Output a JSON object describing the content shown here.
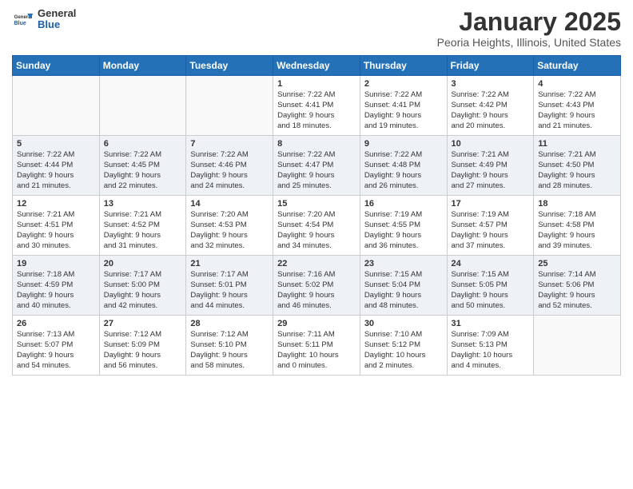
{
  "header": {
    "logo_general": "General",
    "logo_blue": "Blue",
    "month": "January 2025",
    "location": "Peoria Heights, Illinois, United States"
  },
  "days_of_week": [
    "Sunday",
    "Monday",
    "Tuesday",
    "Wednesday",
    "Thursday",
    "Friday",
    "Saturday"
  ],
  "weeks": [
    [
      {
        "day": "",
        "info": ""
      },
      {
        "day": "",
        "info": ""
      },
      {
        "day": "",
        "info": ""
      },
      {
        "day": "1",
        "info": "Sunrise: 7:22 AM\nSunset: 4:41 PM\nDaylight: 9 hours\nand 18 minutes."
      },
      {
        "day": "2",
        "info": "Sunrise: 7:22 AM\nSunset: 4:41 PM\nDaylight: 9 hours\nand 19 minutes."
      },
      {
        "day": "3",
        "info": "Sunrise: 7:22 AM\nSunset: 4:42 PM\nDaylight: 9 hours\nand 20 minutes."
      },
      {
        "day": "4",
        "info": "Sunrise: 7:22 AM\nSunset: 4:43 PM\nDaylight: 9 hours\nand 21 minutes."
      }
    ],
    [
      {
        "day": "5",
        "info": "Sunrise: 7:22 AM\nSunset: 4:44 PM\nDaylight: 9 hours\nand 21 minutes."
      },
      {
        "day": "6",
        "info": "Sunrise: 7:22 AM\nSunset: 4:45 PM\nDaylight: 9 hours\nand 22 minutes."
      },
      {
        "day": "7",
        "info": "Sunrise: 7:22 AM\nSunset: 4:46 PM\nDaylight: 9 hours\nand 24 minutes."
      },
      {
        "day": "8",
        "info": "Sunrise: 7:22 AM\nSunset: 4:47 PM\nDaylight: 9 hours\nand 25 minutes."
      },
      {
        "day": "9",
        "info": "Sunrise: 7:22 AM\nSunset: 4:48 PM\nDaylight: 9 hours\nand 26 minutes."
      },
      {
        "day": "10",
        "info": "Sunrise: 7:21 AM\nSunset: 4:49 PM\nDaylight: 9 hours\nand 27 minutes."
      },
      {
        "day": "11",
        "info": "Sunrise: 7:21 AM\nSunset: 4:50 PM\nDaylight: 9 hours\nand 28 minutes."
      }
    ],
    [
      {
        "day": "12",
        "info": "Sunrise: 7:21 AM\nSunset: 4:51 PM\nDaylight: 9 hours\nand 30 minutes."
      },
      {
        "day": "13",
        "info": "Sunrise: 7:21 AM\nSunset: 4:52 PM\nDaylight: 9 hours\nand 31 minutes."
      },
      {
        "day": "14",
        "info": "Sunrise: 7:20 AM\nSunset: 4:53 PM\nDaylight: 9 hours\nand 32 minutes."
      },
      {
        "day": "15",
        "info": "Sunrise: 7:20 AM\nSunset: 4:54 PM\nDaylight: 9 hours\nand 34 minutes."
      },
      {
        "day": "16",
        "info": "Sunrise: 7:19 AM\nSunset: 4:55 PM\nDaylight: 9 hours\nand 36 minutes."
      },
      {
        "day": "17",
        "info": "Sunrise: 7:19 AM\nSunset: 4:57 PM\nDaylight: 9 hours\nand 37 minutes."
      },
      {
        "day": "18",
        "info": "Sunrise: 7:18 AM\nSunset: 4:58 PM\nDaylight: 9 hours\nand 39 minutes."
      }
    ],
    [
      {
        "day": "19",
        "info": "Sunrise: 7:18 AM\nSunset: 4:59 PM\nDaylight: 9 hours\nand 40 minutes."
      },
      {
        "day": "20",
        "info": "Sunrise: 7:17 AM\nSunset: 5:00 PM\nDaylight: 9 hours\nand 42 minutes."
      },
      {
        "day": "21",
        "info": "Sunrise: 7:17 AM\nSunset: 5:01 PM\nDaylight: 9 hours\nand 44 minutes."
      },
      {
        "day": "22",
        "info": "Sunrise: 7:16 AM\nSunset: 5:02 PM\nDaylight: 9 hours\nand 46 minutes."
      },
      {
        "day": "23",
        "info": "Sunrise: 7:15 AM\nSunset: 5:04 PM\nDaylight: 9 hours\nand 48 minutes."
      },
      {
        "day": "24",
        "info": "Sunrise: 7:15 AM\nSunset: 5:05 PM\nDaylight: 9 hours\nand 50 minutes."
      },
      {
        "day": "25",
        "info": "Sunrise: 7:14 AM\nSunset: 5:06 PM\nDaylight: 9 hours\nand 52 minutes."
      }
    ],
    [
      {
        "day": "26",
        "info": "Sunrise: 7:13 AM\nSunset: 5:07 PM\nDaylight: 9 hours\nand 54 minutes."
      },
      {
        "day": "27",
        "info": "Sunrise: 7:12 AM\nSunset: 5:09 PM\nDaylight: 9 hours\nand 56 minutes."
      },
      {
        "day": "28",
        "info": "Sunrise: 7:12 AM\nSunset: 5:10 PM\nDaylight: 9 hours\nand 58 minutes."
      },
      {
        "day": "29",
        "info": "Sunrise: 7:11 AM\nSunset: 5:11 PM\nDaylight: 10 hours\nand 0 minutes."
      },
      {
        "day": "30",
        "info": "Sunrise: 7:10 AM\nSunset: 5:12 PM\nDaylight: 10 hours\nand 2 minutes."
      },
      {
        "day": "31",
        "info": "Sunrise: 7:09 AM\nSunset: 5:13 PM\nDaylight: 10 hours\nand 4 minutes."
      },
      {
        "day": "",
        "info": ""
      }
    ]
  ]
}
